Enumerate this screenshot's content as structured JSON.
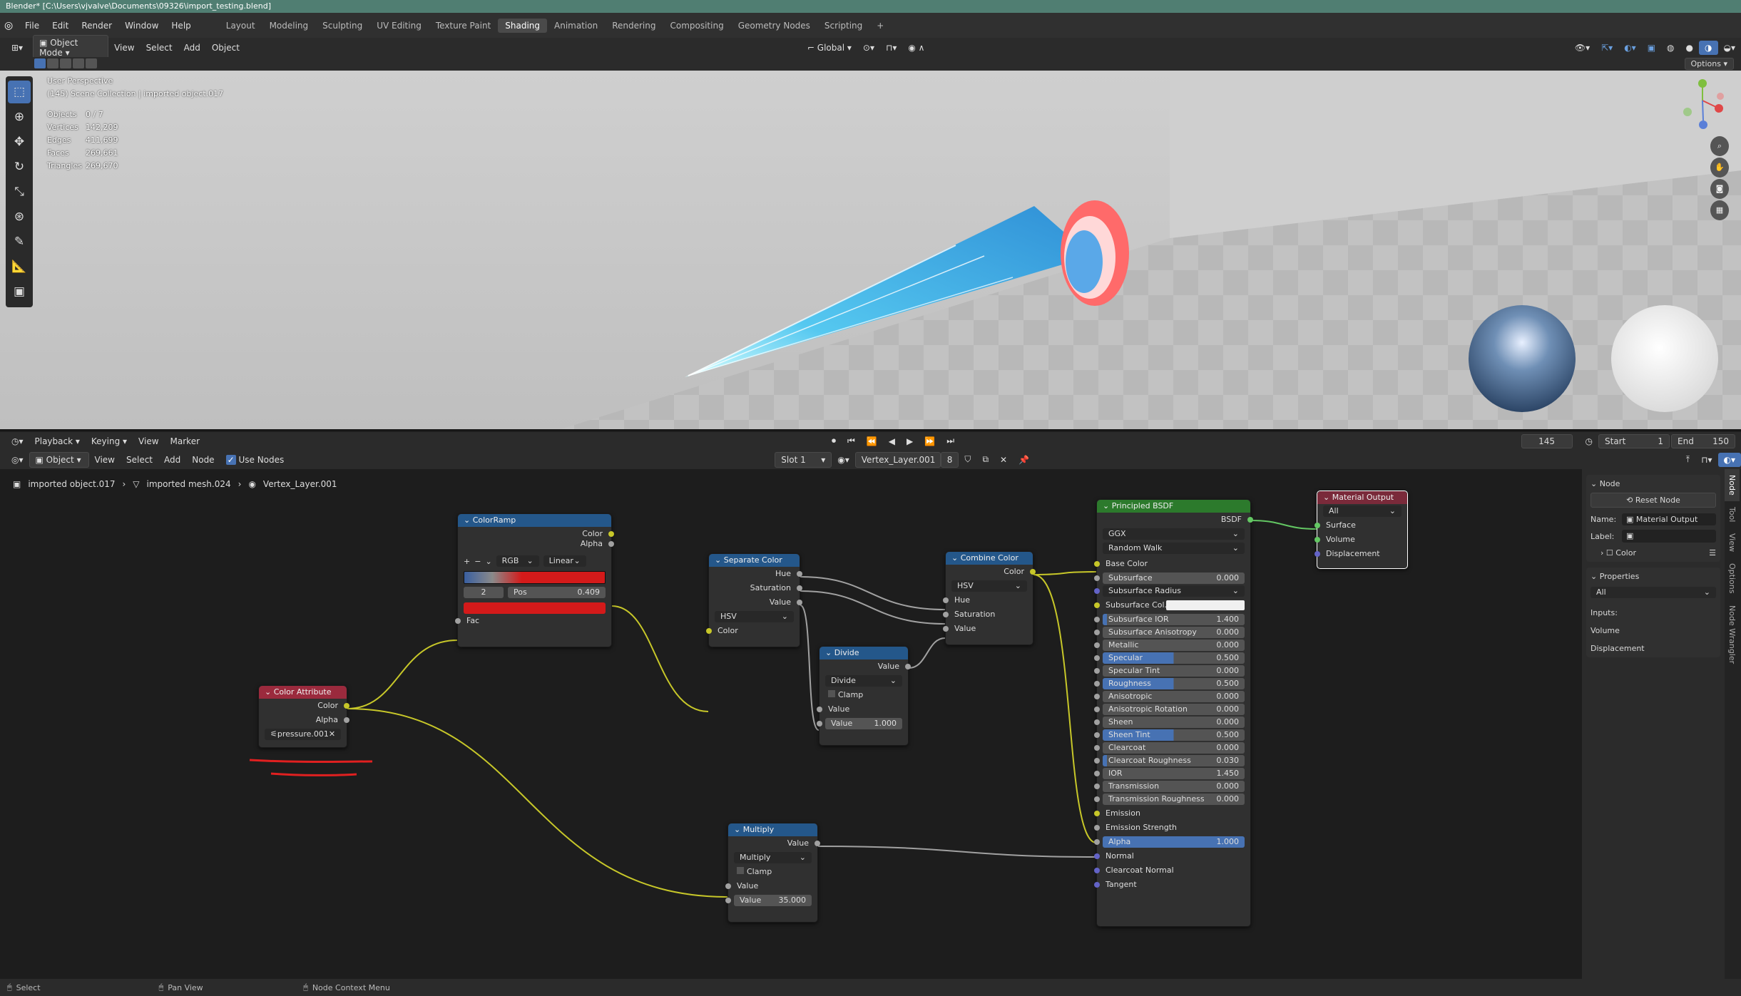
{
  "title_bar": "Blender* [C:\\Users\\vjvalve\\Documents\\09326\\import_testing.blend]",
  "menu": [
    "File",
    "Edit",
    "Render",
    "Window",
    "Help"
  ],
  "workspaces": [
    "Layout",
    "Modeling",
    "Sculpting",
    "UV Editing",
    "Texture Paint",
    "Shading",
    "Animation",
    "Rendering",
    "Compositing",
    "Geometry Nodes",
    "Scripting"
  ],
  "active_workspace": "Shading",
  "viewport_header": {
    "mode": "Object Mode",
    "menus": [
      "View",
      "Select",
      "Add",
      "Object"
    ],
    "orientation": "Global",
    "options": "Options"
  },
  "viewport": {
    "perspective": "User Perspective",
    "collection": "(145) Scene Collection | imported object.017",
    "stats": [
      {
        "label": "Objects",
        "value": "0 / 7"
      },
      {
        "label": "Vertices",
        "value": "142,209"
      },
      {
        "label": "Edges",
        "value": "411,699"
      },
      {
        "label": "Faces",
        "value": "269,661"
      },
      {
        "label": "Triangles",
        "value": "269,670"
      }
    ]
  },
  "timeline": {
    "menus": [
      "Playback",
      "Keying",
      "View",
      "Marker"
    ],
    "frame": "145",
    "start_label": "Start",
    "start": "1",
    "end_label": "End",
    "end": "150"
  },
  "node_header": {
    "type": "Object",
    "menus": [
      "View",
      "Select",
      "Add",
      "Node"
    ],
    "use_nodes": "Use Nodes",
    "slot": "Slot 1",
    "material": "Vertex_Layer.001",
    "users": "8"
  },
  "breadcrumb": [
    "imported object.017",
    "imported mesh.024",
    "Vertex_Layer.001"
  ],
  "nodes": {
    "colorramp": {
      "title": "ColorRamp",
      "out": [
        "Color",
        "Alpha"
      ],
      "mode": "RGB",
      "interp": "Linear",
      "index": "2",
      "pos_label": "Pos",
      "pos": "0.409",
      "in": "Fac"
    },
    "color_attr": {
      "title": "Color Attribute",
      "out": [
        "Color",
        "Alpha"
      ],
      "attr": "pressure.001"
    },
    "separate": {
      "title": "Separate Color",
      "out": [
        "Hue",
        "Saturation",
        "Value"
      ],
      "mode": "HSV",
      "in": "Color"
    },
    "divide": {
      "title": "Divide",
      "out": "Value",
      "op": "Divide",
      "clamp": "Clamp",
      "in": "Value",
      "val_label": "Value",
      "val": "1.000"
    },
    "combine": {
      "title": "Combine Color",
      "out": "Color",
      "mode": "HSV",
      "in": [
        "Hue",
        "Saturation",
        "Value"
      ]
    },
    "multiply": {
      "title": "Multiply",
      "out": "Value",
      "op": "Multiply",
      "clamp": "Clamp",
      "in": "Value",
      "val_label": "Value",
      "val": "35.000"
    },
    "bsdf": {
      "title": "Principled BSDF",
      "out": "BSDF",
      "dist": "GGX",
      "sss": "Random Walk",
      "base": "Base Color",
      "rows": [
        {
          "l": "Subsurface",
          "v": "0.000",
          "p": 0
        },
        {
          "l": "Subsurface Radius",
          "dd": true
        },
        {
          "l": "Subsurface Col...",
          "color": true
        },
        {
          "l": "Subsurface IOR",
          "v": "1.400",
          "p": 3
        },
        {
          "l": "Subsurface Anisotropy",
          "v": "0.000",
          "p": 0
        },
        {
          "l": "Metallic",
          "v": "0.000",
          "p": 0
        },
        {
          "l": "Specular",
          "v": "0.500",
          "p": 50
        },
        {
          "l": "Specular Tint",
          "v": "0.000",
          "p": 0
        },
        {
          "l": "Roughness",
          "v": "0.500",
          "p": 50
        },
        {
          "l": "Anisotropic",
          "v": "0.000",
          "p": 0
        },
        {
          "l": "Anisotropic Rotation",
          "v": "0.000",
          "p": 0
        },
        {
          "l": "Sheen",
          "v": "0.000",
          "p": 0
        },
        {
          "l": "Sheen Tint",
          "v": "0.500",
          "p": 50
        },
        {
          "l": "Clearcoat",
          "v": "0.000",
          "p": 0
        },
        {
          "l": "Clearcoat Roughness",
          "v": "0.030",
          "p": 3
        },
        {
          "l": "IOR",
          "v": "1.450",
          "p": 0
        },
        {
          "l": "Transmission",
          "v": "0.000",
          "p": 0
        },
        {
          "l": "Transmission Roughness",
          "v": "0.000",
          "p": 0
        }
      ],
      "emission": "Emission",
      "emission_strength": "Emission Strength",
      "alpha": "Alpha",
      "alpha_v": "1.000",
      "tail": [
        "Normal",
        "Clearcoat Normal",
        "Tangent"
      ]
    },
    "output": {
      "title": "Material Output",
      "target": "All",
      "in": [
        "Surface",
        "Volume",
        "Displacement"
      ]
    }
  },
  "sidebar": {
    "node_section": "Node",
    "reset": "Reset Node",
    "name_label": "Name:",
    "name": "Material Output",
    "label_label": "Label:",
    "color": "Color",
    "properties": "Properties",
    "target": "All",
    "inputs": "Inputs:",
    "items": [
      "Volume",
      "Displacement"
    ],
    "tabs": [
      "Node",
      "Tool",
      "View",
      "Options",
      "Node Wrangler"
    ]
  },
  "status": {
    "select": "Select",
    "pan": "Pan View",
    "context": "Node Context Menu"
  },
  "colors": {
    "accent": "#4772b3",
    "title_bar": "#507e72",
    "link_yellow": "#c7c729",
    "annotation_red": "#e02020"
  }
}
